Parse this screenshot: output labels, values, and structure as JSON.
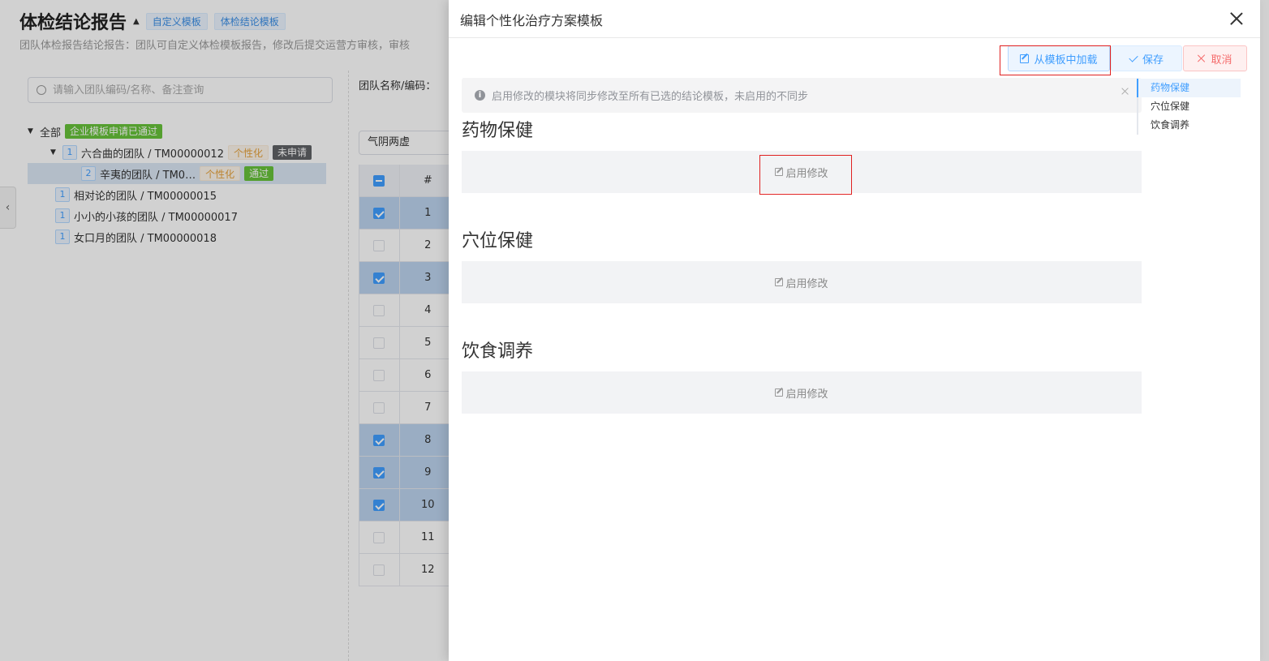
{
  "background": {
    "title": "体检结论报告",
    "tag_custom": "自定义模板",
    "tag_conclusion": "体检结论模板",
    "description": "团队体检报告结论报告：团队可自定义体检模板报告，修改后提交运营方审核，审核",
    "search_placeholder": "请输入团队编码/名称、备注查询",
    "tree": {
      "root_label": "全部",
      "root_tag": "企业模板申请已通过",
      "items": [
        {
          "num": "1",
          "label": "六合曲的团队 / TM00000012",
          "tag1": "个性化",
          "tag2": "未申请"
        },
        {
          "num": "2",
          "label": "辛夷的团队 / TM0…",
          "tag1": "个性化",
          "tag2": "通过"
        },
        {
          "num": "1",
          "label": "相对论的团队 / TM00000015"
        },
        {
          "num": "1",
          "label": "小小的小孩的团队 / TM00000017"
        },
        {
          "num": "1",
          "label": "女口月的团队 / TM00000018"
        }
      ]
    },
    "filter_label": "团队名称/编码：",
    "filter_value": "气阴两虚",
    "table": {
      "header_num": "#",
      "rows": [
        {
          "n": "1",
          "checked": true
        },
        {
          "n": "2",
          "checked": false
        },
        {
          "n": "3",
          "checked": true
        },
        {
          "n": "4",
          "checked": false
        },
        {
          "n": "5",
          "checked": false
        },
        {
          "n": "6",
          "checked": false
        },
        {
          "n": "7",
          "checked": false
        },
        {
          "n": "8",
          "checked": true
        },
        {
          "n": "9",
          "checked": true
        },
        {
          "n": "10",
          "checked": true
        },
        {
          "n": "11",
          "checked": false
        },
        {
          "n": "12",
          "checked": false
        }
      ]
    }
  },
  "drawer": {
    "title": "编辑个性化治疗方案模板",
    "buttons": {
      "load": "从模板中加载",
      "save": "保存",
      "cancel": "取消"
    },
    "alert": "启用修改的模块将同步修改至所有已选的结论模板，未启用的不同步",
    "sections": [
      {
        "title": "药物保健",
        "action": "启用修改"
      },
      {
        "title": "穴位保健",
        "action": "启用修改"
      },
      {
        "title": "饮食调养",
        "action": "启用修改"
      }
    ],
    "anchors": [
      "药物保健",
      "穴位保健",
      "饮食调养"
    ]
  }
}
